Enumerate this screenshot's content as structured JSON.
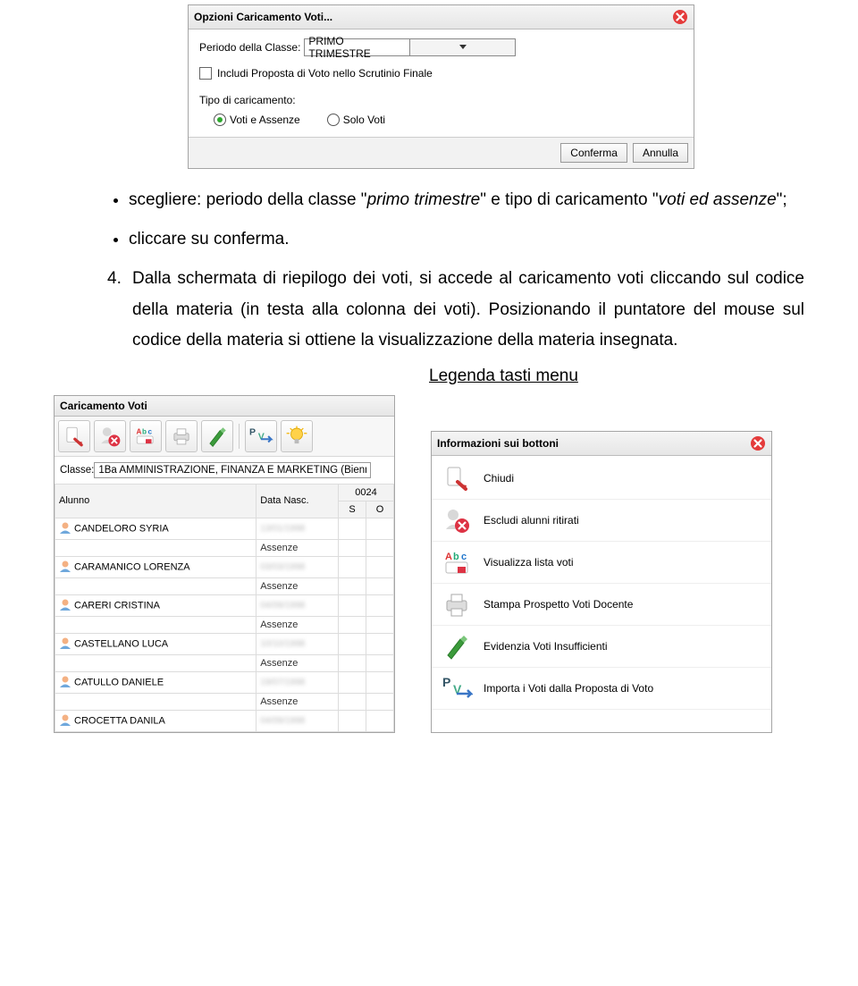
{
  "dialog1": {
    "title": "Opzioni Caricamento Voti...",
    "periodo_label": "Periodo della Classe:",
    "periodo_value": "PRIMO TRIMESTRE",
    "includi_label": "Includi Proposta di Voto nello Scrutinio Finale",
    "tipo_label": "Tipo di caricamento:",
    "radio1": "Voti e Assenze",
    "radio2": "Solo Voti",
    "conferma": "Conferma",
    "annulla": "Annulla"
  },
  "text": {
    "li1_a": "scegliere: periodo della classe \"",
    "li1_em1": "primo trimestre",
    "li1_b": "\" e tipo di caricamento \"",
    "li1_em2": "voti ed assenze",
    "li1_c": "\";",
    "li2": "cliccare su conferma.",
    "num": "4.",
    "p4": "Dalla schermata di riepilogo dei voti, si accede al caricamento voti cliccando sul codice della materia (in testa alla colonna dei voti). Posizionando il puntatore del mouse sul codice della materia si ottiene la visualizzazione della materia insegnata.",
    "legend": "Legenda tasti menu"
  },
  "left": {
    "title": "Caricamento Voti",
    "classe_label": "Classe:",
    "classe_value": "1Ba AMMINISTRAZIONE, FINANZA E MARKETING (Bienn",
    "col_alunno": "Alunno",
    "col_data": "Data Nasc.",
    "col_code": "0024",
    "col_s": "S",
    "col_o": "O",
    "assenze": "Assenze",
    "students": [
      "CANDELORO SYRIA",
      "CARAMANICO LORENZA",
      "CARERI CRISTINA",
      "CASTELLANO LUCA",
      "CATULLO DANIELE",
      "CROCETTA DANILA"
    ]
  },
  "right": {
    "title": "Informazioni sui bottoni",
    "rows": [
      "Chiudi",
      "Escludi alunni ritirati",
      "Visualizza lista voti",
      "Stampa Prospetto Voti Docente",
      "Evidenzia Voti Insufficienti",
      "Importa i Voti dalla Proposta di Voto"
    ]
  }
}
